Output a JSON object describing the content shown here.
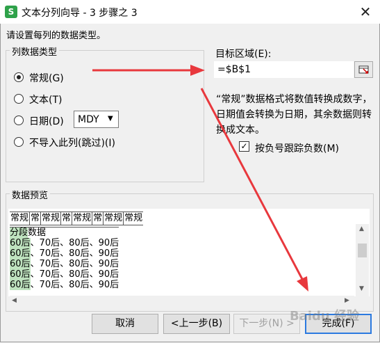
{
  "window": {
    "app_icon": "S",
    "title": "文本分列向导 - 3 步骤之 3",
    "close_icon": "✕",
    "instruction": "请设置每列的数据类型。"
  },
  "column_format": {
    "legend": "列数据类型",
    "options": [
      {
        "label": "常规(G)",
        "selected": true
      },
      {
        "label": "文本(T)",
        "selected": false
      },
      {
        "label": "日期(D)",
        "selected": false
      },
      {
        "label": "不导入此列(跳过)(I)",
        "selected": false
      }
    ],
    "date_format": "MDY"
  },
  "target": {
    "label": "目标区域(E):",
    "value": "=$B$1"
  },
  "description": "“常规”数据格式将数值转换成数字，日期值会转换为日期，其余数据则转换成文本。",
  "negative": {
    "checked": true,
    "check_glyph": "✓",
    "label": "按负号跟踪负数(M)"
  },
  "preview": {
    "legend": "数据预览",
    "headers": [
      "常规",
      "常",
      "常规",
      "常",
      "常规",
      "常",
      "常规",
      "常规"
    ],
    "rows": [
      [
        "分段",
        "数据"
      ],
      [
        "60后",
        "、70后、80后、90后"
      ],
      [
        "60后",
        "、70后、80后、90后"
      ],
      [
        "60后",
        "、70后、80后、90后"
      ],
      [
        "60后",
        "、70后、80后、90后"
      ],
      [
        "60后",
        "、70后、80后、90后"
      ]
    ]
  },
  "buttons": {
    "cancel": "取消",
    "prev": "<上一步(B)",
    "next": "下一步(N) >",
    "finish": "完成(F)"
  },
  "watermark": "Baidu 经验",
  "colors": {
    "accent": "#2b7ae0",
    "arrow": "#e8383d",
    "highlight": "#bfe3bf"
  }
}
